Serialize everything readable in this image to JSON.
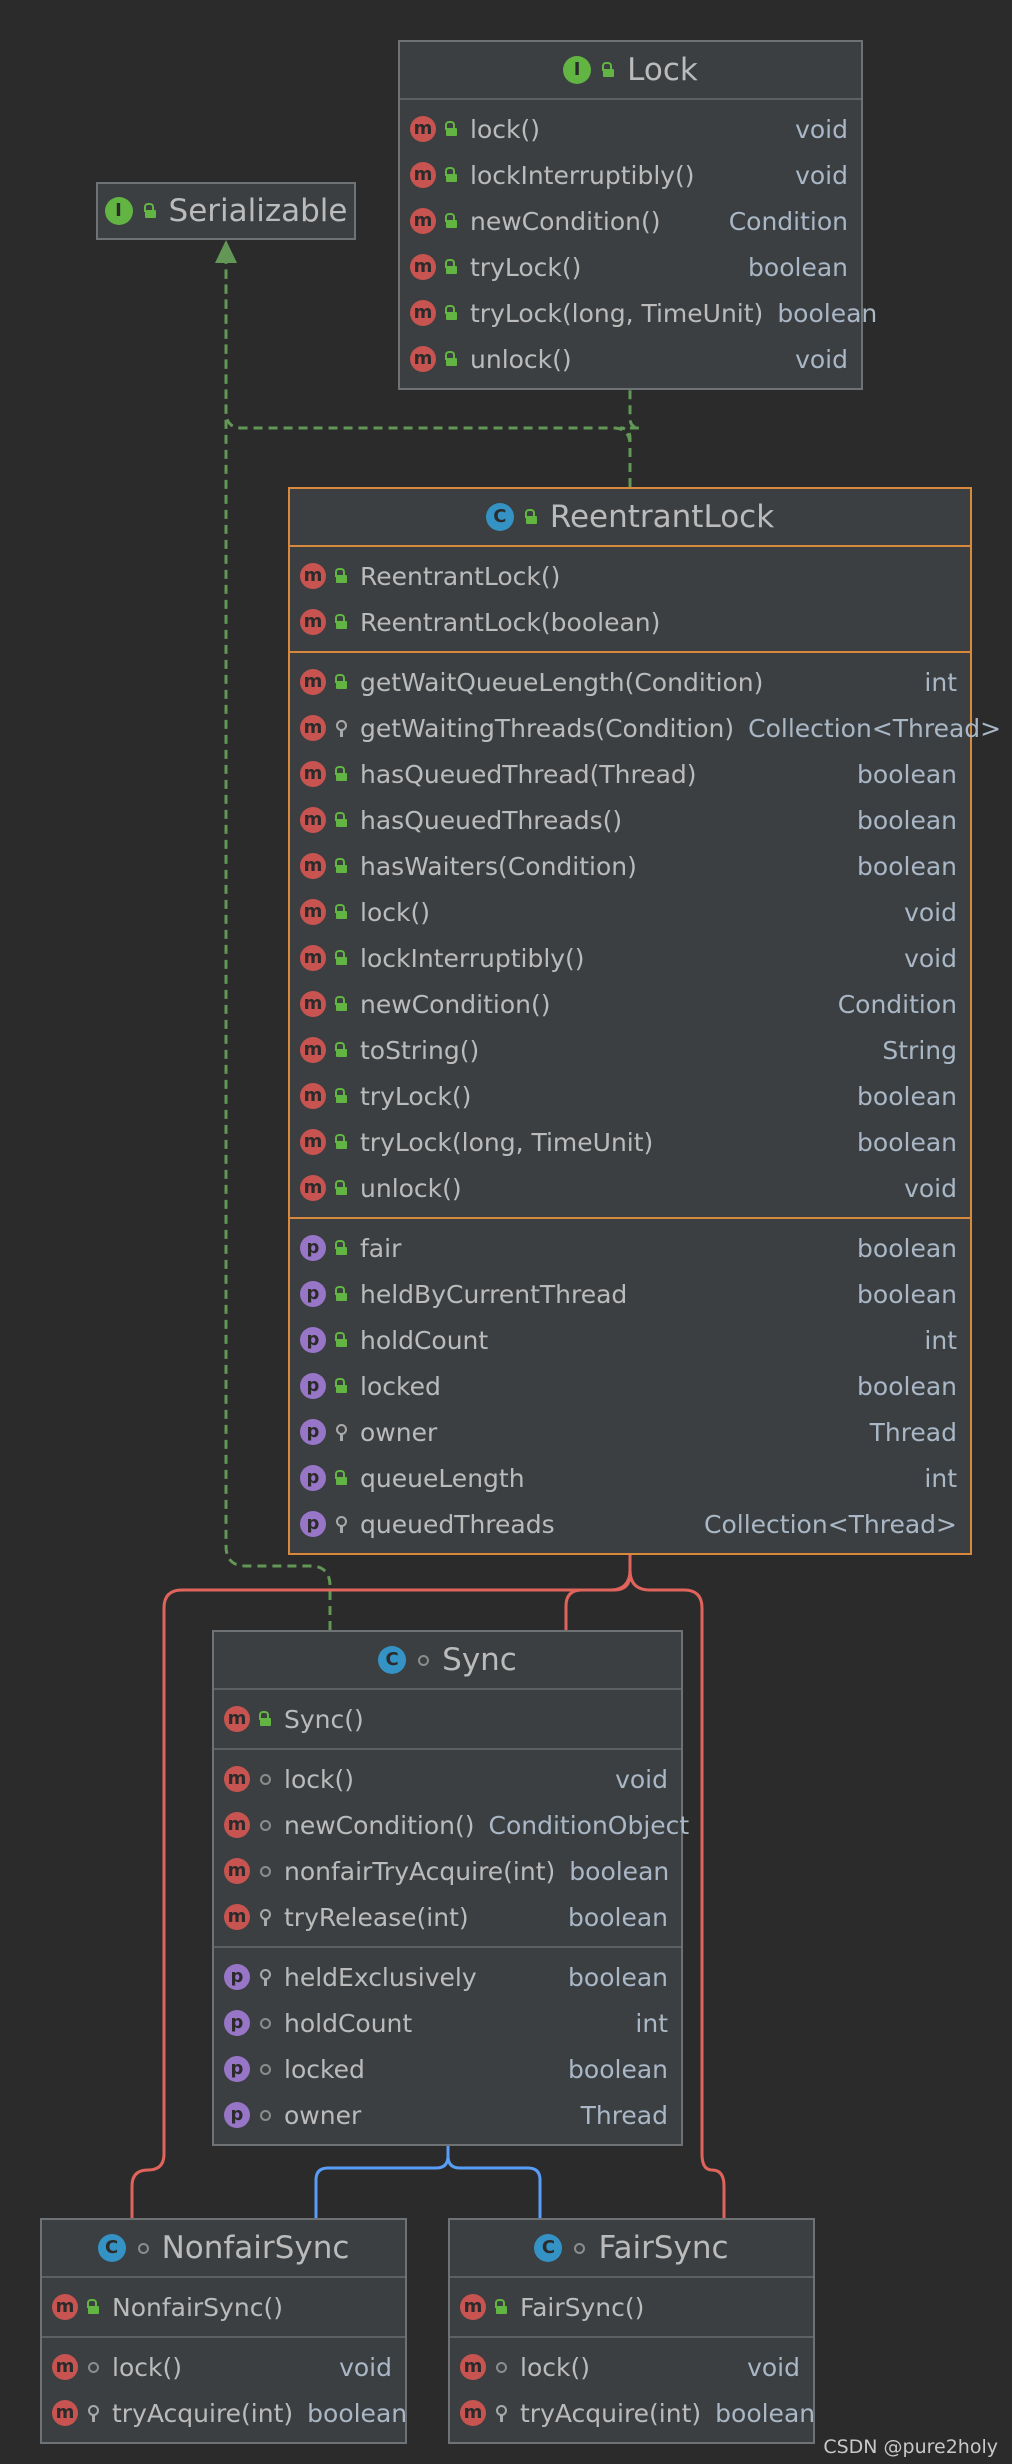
{
  "classes": {
    "lock": {
      "kind": "I",
      "name": "Lock",
      "sections": [
        [
          {
            "kind": "m",
            "vis": "pub",
            "name": "lock()",
            "type": "void"
          },
          {
            "kind": "m",
            "vis": "pub",
            "name": "lockInterruptibly()",
            "type": "void"
          },
          {
            "kind": "m",
            "vis": "pub",
            "name": "newCondition()",
            "type": "Condition"
          },
          {
            "kind": "m",
            "vis": "pub",
            "name": "tryLock()",
            "type": "boolean"
          },
          {
            "kind": "m",
            "vis": "pub",
            "name": "tryLock(long, TimeUnit)",
            "type": "boolean"
          },
          {
            "kind": "m",
            "vis": "pub",
            "name": "unlock()",
            "type": "void"
          }
        ]
      ]
    },
    "serializable": {
      "kind": "I",
      "name": "Serializable",
      "sections": []
    },
    "reentrantlock": {
      "kind": "C",
      "name": "ReentrantLock",
      "selected": true,
      "sections": [
        [
          {
            "kind": "m",
            "vis": "pub",
            "name": "ReentrantLock()",
            "type": ""
          },
          {
            "kind": "m",
            "vis": "pub",
            "name": "ReentrantLock(boolean)",
            "type": ""
          }
        ],
        [
          {
            "kind": "m",
            "vis": "pub",
            "name": "getWaitQueueLength(Condition)",
            "type": "int"
          },
          {
            "kind": "m",
            "vis": "prv",
            "name": "getWaitingThreads(Condition)",
            "type": "Collection<Thread>"
          },
          {
            "kind": "m",
            "vis": "pub",
            "name": "hasQueuedThread(Thread)",
            "type": "boolean"
          },
          {
            "kind": "m",
            "vis": "pub",
            "name": "hasQueuedThreads()",
            "type": "boolean"
          },
          {
            "kind": "m",
            "vis": "pub",
            "name": "hasWaiters(Condition)",
            "type": "boolean"
          },
          {
            "kind": "m",
            "vis": "pub",
            "name": "lock()",
            "type": "void"
          },
          {
            "kind": "m",
            "vis": "pub",
            "name": "lockInterruptibly()",
            "type": "void"
          },
          {
            "kind": "m",
            "vis": "pub",
            "name": "newCondition()",
            "type": "Condition"
          },
          {
            "kind": "m",
            "vis": "pub",
            "name": "toString()",
            "type": "String"
          },
          {
            "kind": "m",
            "vis": "pub",
            "name": "tryLock()",
            "type": "boolean"
          },
          {
            "kind": "m",
            "vis": "pub",
            "name": "tryLock(long, TimeUnit)",
            "type": "boolean"
          },
          {
            "kind": "m",
            "vis": "pub",
            "name": "unlock()",
            "type": "void"
          }
        ],
        [
          {
            "kind": "p",
            "vis": "pub",
            "name": "fair",
            "type": "boolean"
          },
          {
            "kind": "p",
            "vis": "pub",
            "name": "heldByCurrentThread",
            "type": "boolean"
          },
          {
            "kind": "p",
            "vis": "pub",
            "name": "holdCount",
            "type": "int"
          },
          {
            "kind": "p",
            "vis": "pub",
            "name": "locked",
            "type": "boolean"
          },
          {
            "kind": "p",
            "vis": "prv",
            "name": "owner",
            "type": "Thread"
          },
          {
            "kind": "p",
            "vis": "pub",
            "name": "queueLength",
            "type": "int"
          },
          {
            "kind": "p",
            "vis": "prv",
            "name": "queuedThreads",
            "type": "Collection<Thread>"
          }
        ]
      ]
    },
    "sync": {
      "kind": "C",
      "name": "Sync",
      "sections": [
        [
          {
            "kind": "m",
            "vis": "pub",
            "name": "Sync()",
            "type": ""
          }
        ],
        [
          {
            "kind": "m",
            "vis": "pkg",
            "name": "lock()",
            "type": "void"
          },
          {
            "kind": "m",
            "vis": "pkg",
            "name": "newCondition()",
            "type": "ConditionObject"
          },
          {
            "kind": "m",
            "vis": "pkg",
            "name": "nonfairTryAcquire(int)",
            "type": "boolean"
          },
          {
            "kind": "m",
            "vis": "prv",
            "name": "tryRelease(int)",
            "type": "boolean"
          }
        ],
        [
          {
            "kind": "p",
            "vis": "prv",
            "name": "heldExclusively",
            "type": "boolean"
          },
          {
            "kind": "p",
            "vis": "pkg",
            "name": "holdCount",
            "type": "int"
          },
          {
            "kind": "p",
            "vis": "pkg",
            "name": "locked",
            "type": "boolean"
          },
          {
            "kind": "p",
            "vis": "pkg",
            "name": "owner",
            "type": "Thread"
          }
        ]
      ]
    },
    "nonfairsync": {
      "kind": "C",
      "name": "NonfairSync",
      "sections": [
        [
          {
            "kind": "m",
            "vis": "pub",
            "name": "NonfairSync()",
            "type": ""
          }
        ],
        [
          {
            "kind": "m",
            "vis": "pkg",
            "name": "lock()",
            "type": "void"
          },
          {
            "kind": "m",
            "vis": "prv",
            "name": "tryAcquire(int)",
            "type": "boolean"
          }
        ]
      ]
    },
    "fairsync": {
      "kind": "C",
      "name": "FairSync",
      "sections": [
        [
          {
            "kind": "m",
            "vis": "pub",
            "name": "FairSync()",
            "type": ""
          }
        ],
        [
          {
            "kind": "m",
            "vis": "pkg",
            "name": "lock()",
            "type": "void"
          },
          {
            "kind": "m",
            "vis": "prv",
            "name": "tryAcquire(int)",
            "type": "boolean"
          }
        ]
      ]
    }
  },
  "colors": {
    "background": "#2b2b2b",
    "implements_edge": "#629755",
    "extends_edge": "#589df6",
    "inner_class_edge": "#e0645c",
    "selected_border": "#d8893b"
  },
  "watermark": "CSDN @pure2holy"
}
